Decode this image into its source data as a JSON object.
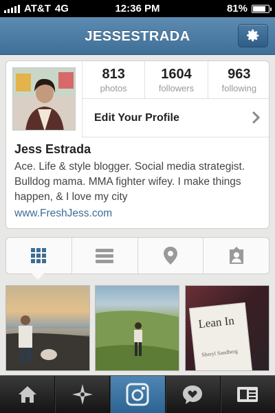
{
  "status_bar": {
    "carrier": "AT&T",
    "network": "4G",
    "time": "12:36 PM",
    "battery": "81%",
    "battery_level": 0.81
  },
  "nav": {
    "title": "JESSESTRADA",
    "settings_icon": "gear-icon"
  },
  "profile": {
    "stats": [
      {
        "value": "813",
        "label": "photos"
      },
      {
        "value": "1604",
        "label": "followers"
      },
      {
        "value": "963",
        "label": "following"
      }
    ],
    "edit_label": "Edit Your Profile",
    "name": "Jess Estrada",
    "bio": "Ace. Life & style blogger. Social media strategist. Bulldog mama. MMA fighter wifey. I make things happen, & I love my city",
    "website": "www.FreshJess.com"
  },
  "view_tabs": [
    "grid-icon",
    "list-icon",
    "map-pin-icon",
    "tagged-person-icon"
  ],
  "photo_tile_book": {
    "title": "Lean In",
    "author": "Sheryl Sandberg"
  },
  "tab_bar": [
    "home-icon",
    "explore-star-icon",
    "camera-icon",
    "news-heart-icon",
    "profile-card-icon"
  ],
  "colors": {
    "nav_blue": "#4f7fa8",
    "link_blue": "#3e6d93",
    "tab_active": "#3f76a4"
  }
}
